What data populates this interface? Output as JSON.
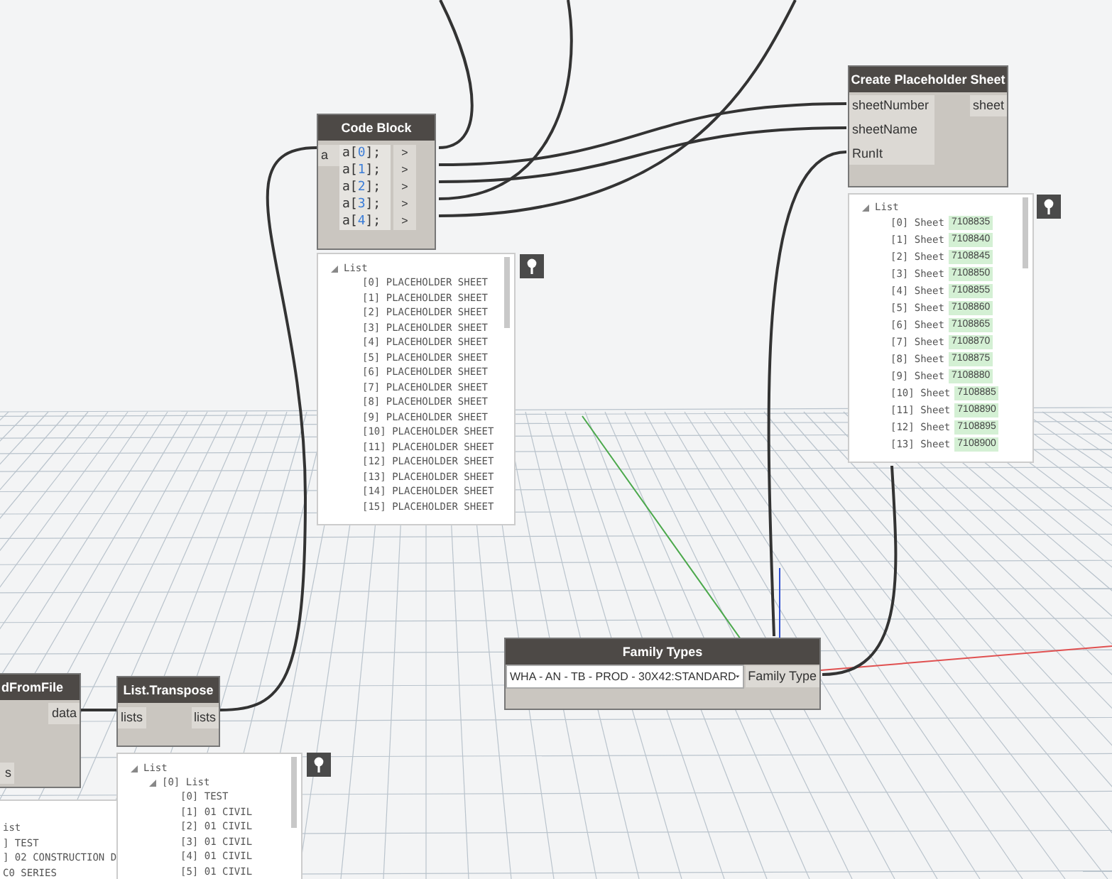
{
  "code_block": {
    "title": "Code Block",
    "input": "a",
    "lines": [
      {
        "parts": [
          "a[",
          "0",
          "];"
        ],
        "output": ">"
      },
      {
        "parts": [
          "a[",
          "1",
          "];"
        ],
        "output": ">"
      },
      {
        "parts": [
          "a[",
          "2",
          "];"
        ],
        "output": ">"
      },
      {
        "parts": [
          "a[",
          "3",
          "];"
        ],
        "output": ">"
      },
      {
        "parts": [
          "a[",
          "4",
          "];"
        ],
        "output": ">"
      }
    ],
    "preview": {
      "root": "List",
      "items": [
        "[0] PLACEHOLDER SHEET",
        "[1] PLACEHOLDER SHEET",
        "[2] PLACEHOLDER SHEET",
        "[3] PLACEHOLDER SHEET",
        "[4] PLACEHOLDER SHEET",
        "[5] PLACEHOLDER SHEET",
        "[6] PLACEHOLDER SHEET",
        "[7] PLACEHOLDER SHEET",
        "[8] PLACEHOLDER SHEET",
        "[9] PLACEHOLDER SHEET",
        "[10] PLACEHOLDER SHEET",
        "[11] PLACEHOLDER SHEET",
        "[12] PLACEHOLDER SHEET",
        "[13] PLACEHOLDER SHEET",
        "[14] PLACEHOLDER SHEET",
        "[15] PLACEHOLDER SHEET"
      ]
    }
  },
  "create_sheet": {
    "title": "Create Placeholder Sheet",
    "inputs": [
      "sheetNumber",
      "sheetName",
      "RunIt"
    ],
    "output": "sheet",
    "preview": {
      "root": "List",
      "items": [
        {
          "index": "[0]",
          "label": "Sheet",
          "value": "7108835"
        },
        {
          "index": "[1]",
          "label": "Sheet",
          "value": "7108840"
        },
        {
          "index": "[2]",
          "label": "Sheet",
          "value": "7108845"
        },
        {
          "index": "[3]",
          "label": "Sheet",
          "value": "7108850"
        },
        {
          "index": "[4]",
          "label": "Sheet",
          "value": "7108855"
        },
        {
          "index": "[5]",
          "label": "Sheet",
          "value": "7108860"
        },
        {
          "index": "[6]",
          "label": "Sheet",
          "value": "7108865"
        },
        {
          "index": "[7]",
          "label": "Sheet",
          "value": "7108870"
        },
        {
          "index": "[8]",
          "label": "Sheet",
          "value": "7108875"
        },
        {
          "index": "[9]",
          "label": "Sheet",
          "value": "7108880"
        },
        {
          "index": "[10]",
          "label": "Sheet",
          "value": "7108885"
        },
        {
          "index": "[11]",
          "label": "Sheet",
          "value": "7108890"
        },
        {
          "index": "[12]",
          "label": "Sheet",
          "value": "7108895"
        },
        {
          "index": "[13]",
          "label": "Sheet",
          "value": "7108900"
        }
      ]
    }
  },
  "family_types": {
    "title": "Family Types",
    "value": "WHA - AN - TB - PROD - 30X42:STANDARD",
    "output": "Family Type"
  },
  "read_from_file": {
    "title": "dFromFile",
    "output": "data",
    "input": "s",
    "preview": {
      "items": [
        "ist",
        "] TEST",
        "] 02 CONSTRUCTION D",
        "C0 SERIES"
      ]
    }
  },
  "list_transpose": {
    "title": "List.Transpose",
    "input": "lists",
    "output": "lists",
    "preview": {
      "root": "List",
      "sublist": "[0] List",
      "items": [
        "[0] TEST",
        "[1] 01 CIVIL",
        "[2] 01 CIVIL",
        "[3] 01 CIVIL",
        "[4] 01 CIVIL",
        "[5] 01 CIVIL"
      ]
    }
  }
}
